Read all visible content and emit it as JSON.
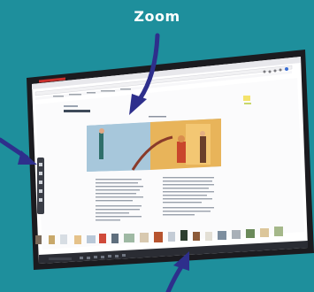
{
  "callout": {
    "label": "Zoom"
  },
  "colors": {
    "background": "#1e8f9c",
    "arrow": "#2e2f8c",
    "bezel": "#1b1b1f",
    "screen": "#ffffff",
    "page_bg": "#f2f3f5"
  },
  "icons": [
    "arrow-pointer-icon",
    "zoom-toolbar",
    "thumbnail-strip",
    "taskbar"
  ]
}
